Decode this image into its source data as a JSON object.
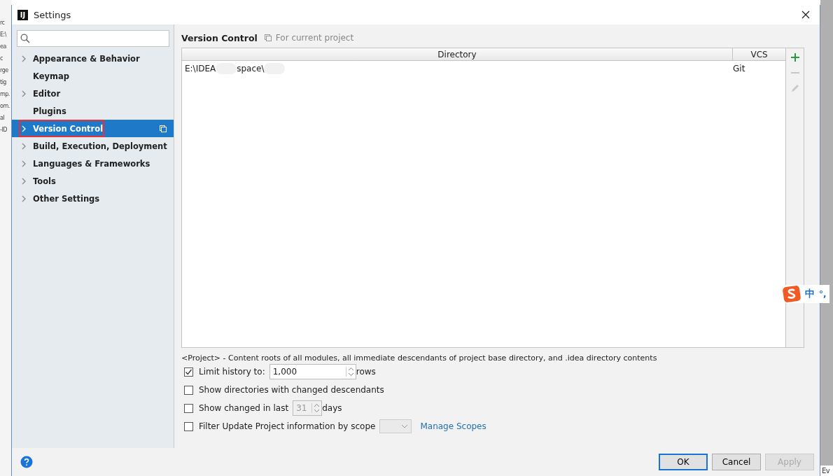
{
  "background_left": [
    "rc",
    "E:\\",
    "ea",
    "c",
    "rge",
    "tig",
    "mp.",
    "om.",
    "al",
    "-ID"
  ],
  "background_right": [
    "Ev"
  ],
  "window": {
    "title": "Settings",
    "logo": "IJ"
  },
  "sidebar": {
    "items": [
      {
        "label": "Appearance & Behavior",
        "has_arrow": true,
        "selected": false,
        "highlighted": false
      },
      {
        "label": "Keymap",
        "has_arrow": false,
        "selected": false,
        "highlighted": false
      },
      {
        "label": "Editor",
        "has_arrow": true,
        "selected": false,
        "highlighted": false
      },
      {
        "label": "Plugins",
        "has_arrow": false,
        "selected": false,
        "highlighted": false
      },
      {
        "label": "Version Control",
        "has_arrow": true,
        "selected": true,
        "highlighted": true
      },
      {
        "label": "Build, Execution, Deployment",
        "has_arrow": true,
        "selected": false,
        "highlighted": false
      },
      {
        "label": "Languages & Frameworks",
        "has_arrow": true,
        "selected": false,
        "highlighted": false
      },
      {
        "label": "Tools",
        "has_arrow": true,
        "selected": false,
        "highlighted": false
      },
      {
        "label": "Other Settings",
        "has_arrow": true,
        "selected": false,
        "highlighted": false
      }
    ]
  },
  "page": {
    "title": "Version Control",
    "scope": "For current project"
  },
  "table": {
    "columns": [
      "Directory",
      "VCS"
    ],
    "rows": [
      {
        "directory_parts": [
          "E:\\IDEA",
          "space\\"
        ],
        "vcs": "Git"
      }
    ]
  },
  "toolbar": [
    {
      "kind": "add",
      "disabled": false
    },
    {
      "kind": "remove",
      "disabled": true
    },
    {
      "kind": "edit",
      "disabled": true
    }
  ],
  "note": "<Project> - Content roots of all modules, all immediate descendants of project base directory, and .idea directory contents",
  "options": [
    {
      "kind": "spinner",
      "label": "Limit history to:",
      "checked": true,
      "value": "1,000",
      "suffix": "rows",
      "disabled": false
    },
    {
      "kind": "plain",
      "label": "Show directories with changed descendants",
      "checked": false
    },
    {
      "kind": "spinner",
      "label": "Show changed in last",
      "checked": false,
      "value": "31",
      "suffix": "days",
      "disabled": true
    },
    {
      "kind": "scope",
      "label": "Filter Update Project information by scope",
      "checked": false,
      "link": "Manage Scopes"
    }
  ],
  "buttons": [
    {
      "label": "OK",
      "default": true,
      "disabled": false
    },
    {
      "label": "Cancel",
      "default": false,
      "disabled": false
    },
    {
      "label": "Apply",
      "default": false,
      "disabled": true
    }
  ],
  "ime": {
    "label": "中",
    "punct": "°,"
  }
}
